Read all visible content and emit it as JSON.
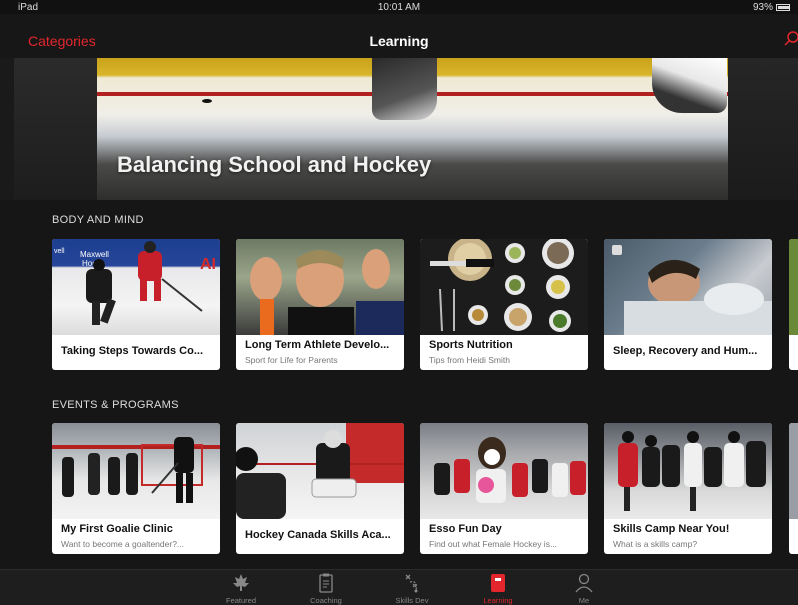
{
  "status": {
    "device": "iPad",
    "time": "10:01 AM",
    "battery": "93%",
    "battery_level": 0.93
  },
  "nav": {
    "categories_label": "Categories",
    "title": "Learning",
    "search_icon": "search-icon"
  },
  "hero": {
    "caption": "Balancing School and Hockey"
  },
  "sections": [
    {
      "title": "BODY AND MIND",
      "cards": [
        {
          "title": "Taking Steps Towards Co...",
          "subtitle": ""
        },
        {
          "title": "Long Term Athlete Develo...",
          "subtitle": "Sport for Life for Parents"
        },
        {
          "title": "Sports Nutrition",
          "subtitle": "Tips from Heidi Smith"
        },
        {
          "title": "Sleep, Recovery and Hum...",
          "subtitle": ""
        }
      ]
    },
    {
      "title": "EVENTS & PROGRAMS",
      "cards": [
        {
          "title": "My First Goalie Clinic",
          "subtitle": "Want to become a goaltender?..."
        },
        {
          "title": "Hockey Canada Skills Aca...",
          "subtitle": ""
        },
        {
          "title": "Esso Fun Day",
          "subtitle": "Find out what Female Hockey is..."
        },
        {
          "title": "Skills Camp Near You!",
          "subtitle": "What is a skills camp?"
        }
      ]
    }
  ],
  "tabs": [
    {
      "label": "Featured",
      "icon": "maple-leaf-icon",
      "active": false
    },
    {
      "label": "Coaching",
      "icon": "clipboard-icon",
      "active": false
    },
    {
      "label": "Skills Dev",
      "icon": "play-diagram-icon",
      "active": false
    },
    {
      "label": "Learning",
      "icon": "book-icon",
      "active": true
    },
    {
      "label": "Me",
      "icon": "person-icon",
      "active": false
    }
  ],
  "colors": {
    "accent": "#e3262d",
    "background": "#161616"
  }
}
